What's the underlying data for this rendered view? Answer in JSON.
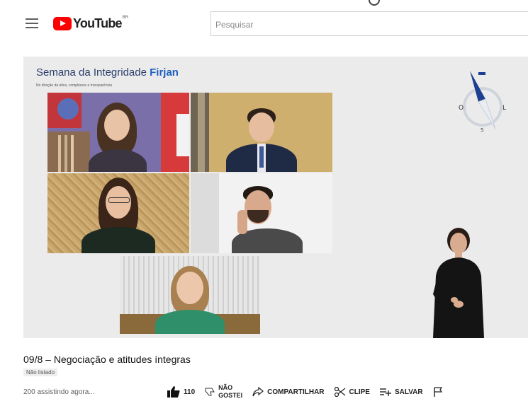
{
  "header": {
    "logo_text": "YouTube",
    "logo_region": "BR",
    "search_placeholder": "Pesquisar"
  },
  "video": {
    "event_title_plain": "Semana da Integridade ",
    "event_title_brand": "Firjan",
    "event_subtitle": "No direção da ética, compliance e transparência",
    "compass_labels": [
      "O",
      "L",
      "S"
    ]
  },
  "meta": {
    "title": "09/8 – Negociação e atitudes íntegras",
    "chip": "Não listado",
    "views": "200 assistindo agora..."
  },
  "actions": {
    "like_count": "110",
    "dislike_line1": "NÃO",
    "dislike_line2": "GOSTEI",
    "share": "COMPARTILHAR",
    "clip": "CLIPE",
    "save": "SALVAR"
  }
}
